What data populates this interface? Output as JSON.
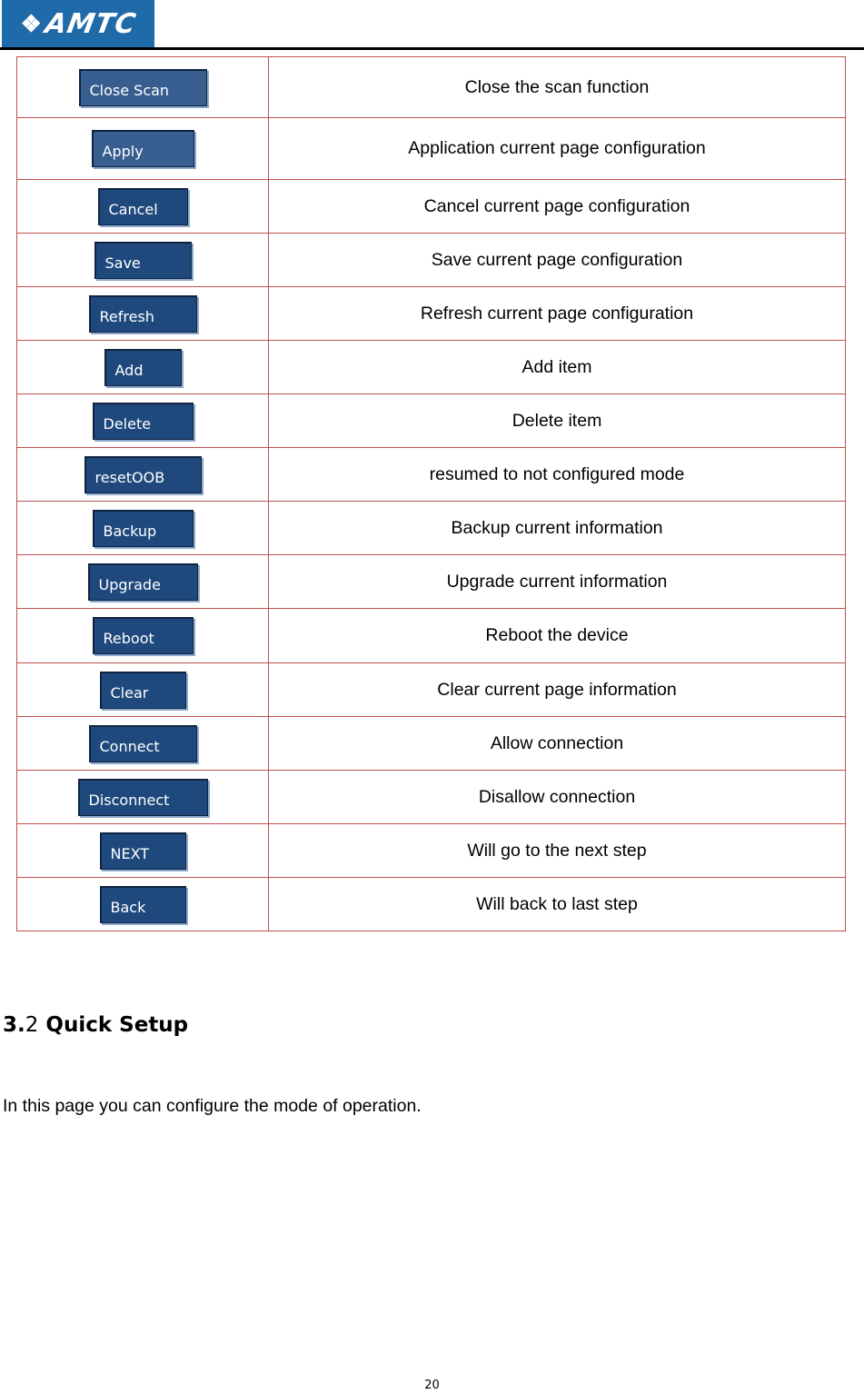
{
  "header": {
    "logo_text": "AMTC",
    "logo_icon": "amtc-logo-icon"
  },
  "colors": {
    "logo_bg": "#1f6aa8",
    "button_bg": "#1f497d",
    "table_border": "#c0504d"
  },
  "table": {
    "rows": [
      {
        "button": "Close Scan",
        "description": "Close the scan function"
      },
      {
        "button": "Apply",
        "description": "Application current page configuration"
      },
      {
        "button": "Cancel",
        "description": "Cancel current page configuration"
      },
      {
        "button": "Save",
        "description": "Save current page configuration"
      },
      {
        "button": "Refresh",
        "description": "Refresh current page configuration"
      },
      {
        "button": "Add",
        "description": "Add item"
      },
      {
        "button": "Delete",
        "description": "Delete item"
      },
      {
        "button": "resetOOB",
        "description": "resumed to not configured mode"
      },
      {
        "button": "Backup",
        "description": "Backup current information"
      },
      {
        "button": "Upgrade",
        "description": "Upgrade current information"
      },
      {
        "button": "Reboot",
        "description": "Reboot the device"
      },
      {
        "button": "Clear",
        "description": "Clear current page information"
      },
      {
        "button": "Connect",
        "description": "Allow connection"
      },
      {
        "button": "Disconnect",
        "description": "Disallow connection"
      },
      {
        "button": "NEXT",
        "description": "Will go to the next step"
      },
      {
        "button": "Back",
        "description": "Will back to last step"
      }
    ]
  },
  "section": {
    "number_major": "3.",
    "number_minor": "2",
    "title": "Quick Setup",
    "body": "In this page you can configure the mode of operation."
  },
  "footer": {
    "page_number": "20"
  }
}
